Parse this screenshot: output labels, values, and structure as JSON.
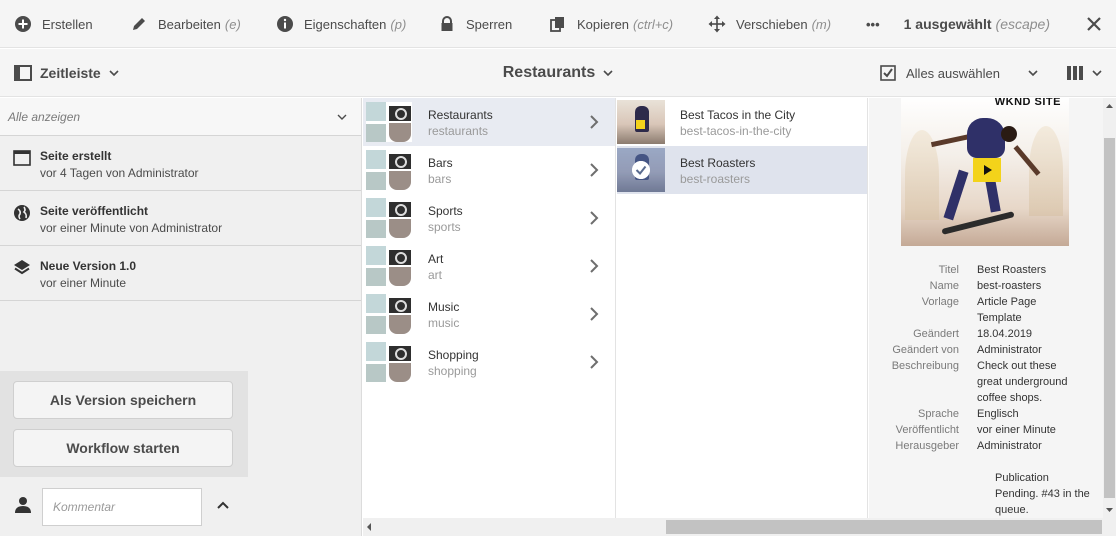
{
  "actionbar": {
    "create": "Erstellen",
    "edit": "Bearbeiten",
    "edit_key": "(e)",
    "properties": "Eigenschaften",
    "properties_key": "(p)",
    "lock": "Sperren",
    "copy": "Kopieren",
    "copy_key": "(ctrl+c)",
    "move": "Verschieben",
    "move_key": "(m)",
    "more": "•••",
    "selected": "1 ausgewählt",
    "selected_key": "(escape)"
  },
  "subbar": {
    "rail": "Zeitleiste",
    "title": "Restaurants",
    "select_all": "Alles auswählen"
  },
  "rail": {
    "filter": "Alle anzeigen",
    "items": [
      {
        "title": "Seite erstellt",
        "sub": "vor 4 Tagen von Administrator",
        "icon": "page-icon"
      },
      {
        "title": "Seite veröffentlicht",
        "sub": "vor einer Minute von Administrator",
        "icon": "globe-icon"
      },
      {
        "title": "Neue Version 1.0",
        "sub": "vor einer Minute",
        "icon": "layers-icon"
      }
    ],
    "save_version": "Als Version speichern",
    "start_workflow": "Workflow starten",
    "comment_placeholder": "Kommentar"
  },
  "column1": {
    "items": [
      {
        "name": "Restaurants",
        "path": "restaurants"
      },
      {
        "name": "Bars",
        "path": "bars"
      },
      {
        "name": "Sports",
        "path": "sports"
      },
      {
        "name": "Art",
        "path": "art"
      },
      {
        "name": "Music",
        "path": "music"
      },
      {
        "name": "Shopping",
        "path": "shopping"
      }
    ]
  },
  "column2": {
    "items": [
      {
        "name": "Best Tacos in the City",
        "path": "best-tacos-in-the-city"
      },
      {
        "name": "Best Roasters",
        "path": "best-roasters"
      }
    ]
  },
  "panel": {
    "brand": "WKND SITE",
    "properties": [
      {
        "key": "Titel",
        "value": "Best Roasters"
      },
      {
        "key": "Name",
        "value": "best-roasters"
      },
      {
        "key": "Vorlage",
        "value": "Article Page Template"
      },
      {
        "key": "Geändert",
        "value": "18.04.2019"
      },
      {
        "key": "Geändert von",
        "value": "Administrator"
      },
      {
        "key": "Beschreibung",
        "value": "Check out these great underground coffee shops."
      },
      {
        "key": "Sprache",
        "value": "Englisch"
      },
      {
        "key": "Veröffentlicht",
        "value": "vor einer Minute"
      },
      {
        "key": "Herausgeber",
        "value": "Administrator"
      }
    ],
    "status": "Publication Pending. #43 in the queue."
  },
  "colors": {
    "toolbar_bg": "#f5f5f5",
    "selected_row": "#dfe3ed",
    "rail_bg": "#f0f0f0",
    "play_button": "#f3d31a"
  }
}
